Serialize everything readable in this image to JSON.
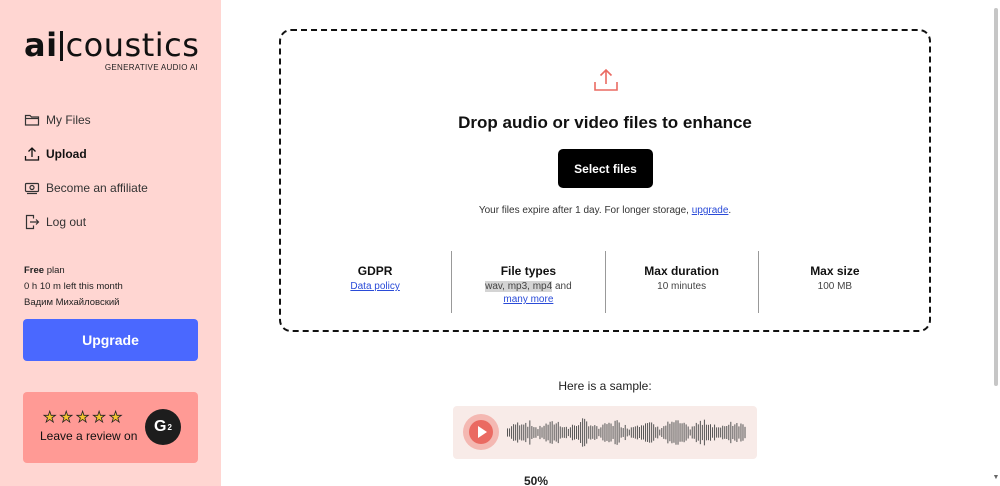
{
  "logo": {
    "ai": "ai",
    "rest": "coustics",
    "tagline": "GENERATIVE AUDIO AI"
  },
  "nav": [
    {
      "label": "My Files",
      "icon": "folder-icon"
    },
    {
      "label": "Upload",
      "icon": "upload-icon",
      "active": true
    },
    {
      "label": "Become an affiliate",
      "icon": "money-icon"
    },
    {
      "label": "Log out",
      "icon": "logout-icon"
    }
  ],
  "plan": {
    "name": "Free",
    "suffix": " plan",
    "remaining": "0 h 10 m left this month",
    "user": "Вадим Михайловский"
  },
  "upgrade_label": "Upgrade",
  "review": {
    "stars": 5,
    "text": "Leave a review on",
    "badge": "G"
  },
  "dropzone": {
    "title": "Drop audio or video files to enhance",
    "select_label": "Select files",
    "expire_text": "Your files expire after 1 day. For longer storage, ",
    "expire_link": "upgrade",
    "expire_end": "."
  },
  "info": [
    {
      "title": "GDPR",
      "link": "Data policy"
    },
    {
      "title": "File types",
      "highlight": "wav, mp3, mp4",
      "after": " and",
      "link": "many more"
    },
    {
      "title": "Max duration",
      "sub": "10 minutes"
    },
    {
      "title": "Max size",
      "sub": "100 MB"
    }
  ],
  "sample": {
    "label": "Here is a sample:",
    "percent": "50%"
  },
  "colors": {
    "sidebar": "#ffd6d2",
    "upgrade": "#4a68ff",
    "review": "#ff9a95",
    "accent": "#ea6a62",
    "player": "#f8ebe8"
  }
}
